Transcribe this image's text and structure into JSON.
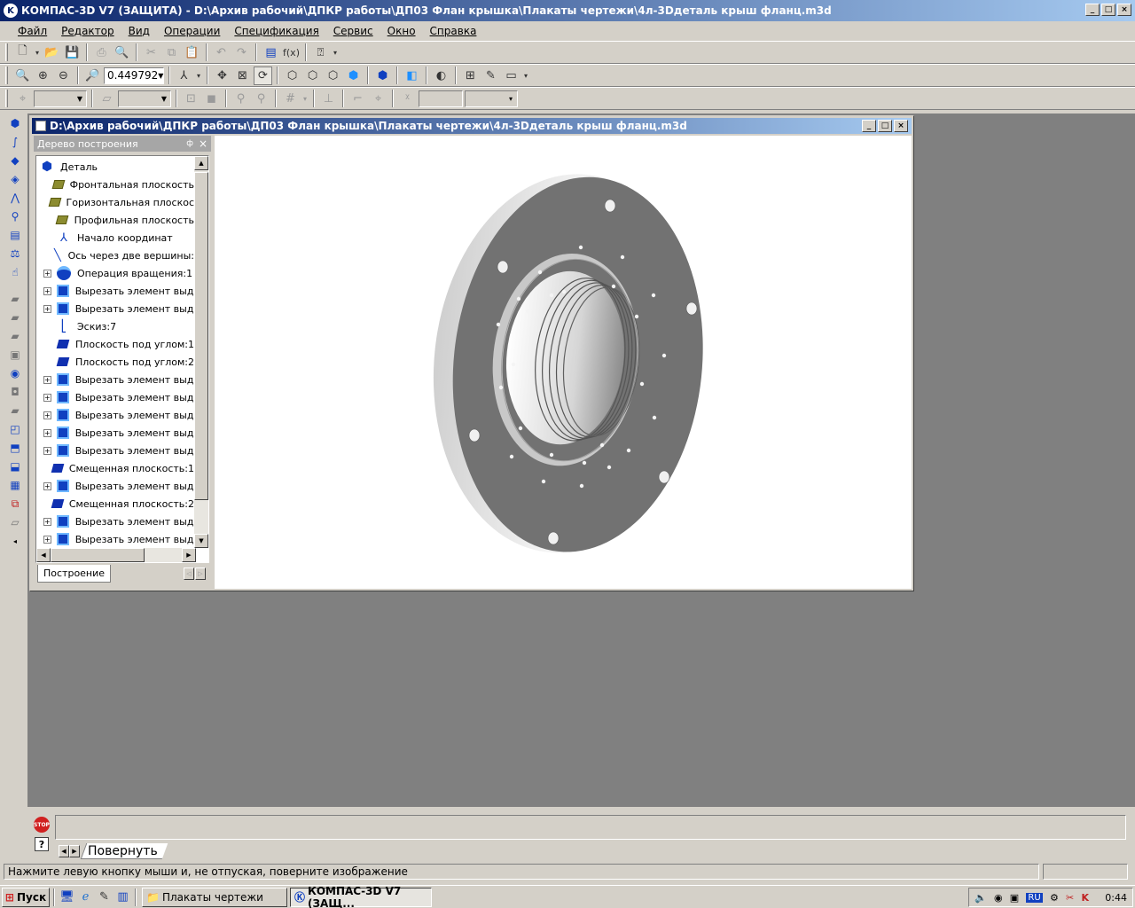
{
  "app": {
    "title": "КОМПАС-3D V7 (ЗАЩИТА) - D:\\Архив рабочий\\ДПКР работы\\ДП03 Флан крышка\\Плакаты чертежи\\4л-3Dдеталь  крыш фланц.m3d",
    "icon": "kompas-logo-icon",
    "caption_buttons": [
      "_",
      "□",
      "×"
    ]
  },
  "menu": [
    "Файл",
    "Редактор",
    "Вид",
    "Операции",
    "Спецификация",
    "Сервис",
    "Окно",
    "Справка"
  ],
  "toolbar_view": {
    "zoom_value": "0.449792"
  },
  "document": {
    "title": "D:\\Архив рабочий\\ДПКР работы\\ДП03 Флан крышка\\Плакаты чертежи\\4л-3Dдеталь  крыш фланц.m3d"
  },
  "tree": {
    "header": "Дерево построения",
    "pin_glyph": "ф",
    "close_glyph": "×",
    "root": "Деталь",
    "items": [
      {
        "label": "Фронтальная плоскость",
        "icon": "plane-icon",
        "expand": false
      },
      {
        "label": "Горизонтальная плоскос",
        "icon": "plane-icon",
        "expand": false
      },
      {
        "label": "Профильная плоскость",
        "icon": "plane-icon",
        "expand": false
      },
      {
        "label": "Начало координат",
        "icon": "origin-icon",
        "expand": false
      },
      {
        "label": "Ось через две вершины:",
        "icon": "axis-icon",
        "expand": false
      },
      {
        "label": "Операция вращения:1",
        "icon": "rotate-op-icon",
        "expand": true
      },
      {
        "label": "Вырезать элемент выдав",
        "icon": "cut-extrude-icon",
        "expand": true
      },
      {
        "label": "Вырезать элемент выдав",
        "icon": "cut-extrude-icon",
        "expand": true
      },
      {
        "label": "Эскиз:7",
        "icon": "sketch-icon",
        "expand": false
      },
      {
        "label": "Плоскость под углом:1",
        "icon": "angle-plane-icon",
        "expand": false
      },
      {
        "label": "Плоскость под углом:2",
        "icon": "angle-plane-icon",
        "expand": false
      },
      {
        "label": "Вырезать элемент выдав",
        "icon": "cut-extrude-icon",
        "expand": true
      },
      {
        "label": "Вырезать элемент выдав",
        "icon": "cut-extrude-icon",
        "expand": true
      },
      {
        "label": "Вырезать элемент выдав",
        "icon": "cut-extrude-icon",
        "expand": true
      },
      {
        "label": "Вырезать элемент выдав",
        "icon": "cut-extrude-icon",
        "expand": true
      },
      {
        "label": "Вырезать элемент выдав",
        "icon": "cut-extrude-icon",
        "expand": true
      },
      {
        "label": "Смещенная плоскость:1",
        "icon": "offset-plane-icon",
        "expand": false
      },
      {
        "label": "Вырезать элемент выдав",
        "icon": "cut-extrude-icon",
        "expand": true
      },
      {
        "label": "Смещенная плоскость:2",
        "icon": "offset-plane-icon",
        "expand": false
      },
      {
        "label": "Вырезать элемент выдав",
        "icon": "cut-extrude-icon",
        "expand": true
      },
      {
        "label": "Вырезать элемент выдав",
        "icon": "cut-extrude-icon",
        "expand": true
      }
    ],
    "tab": "Построение"
  },
  "command": {
    "tab": "Повернуть",
    "stop_label": "STOP",
    "help_glyph": "?"
  },
  "status": {
    "hint": "Нажмите левую кнопку мыши и, не отпуская, поверните изображение"
  },
  "taskbar": {
    "start": "Пуск",
    "tasks": [
      "Плакаты чертежи",
      "КОМПАС-3D V7 (ЗАЩ..."
    ],
    "lang": "RU",
    "clock": "0:44"
  },
  "colors": {
    "title_start": "#0a246a",
    "title_end": "#a6caf0",
    "part_face": "#707070",
    "mdi_bg": "#808080"
  }
}
